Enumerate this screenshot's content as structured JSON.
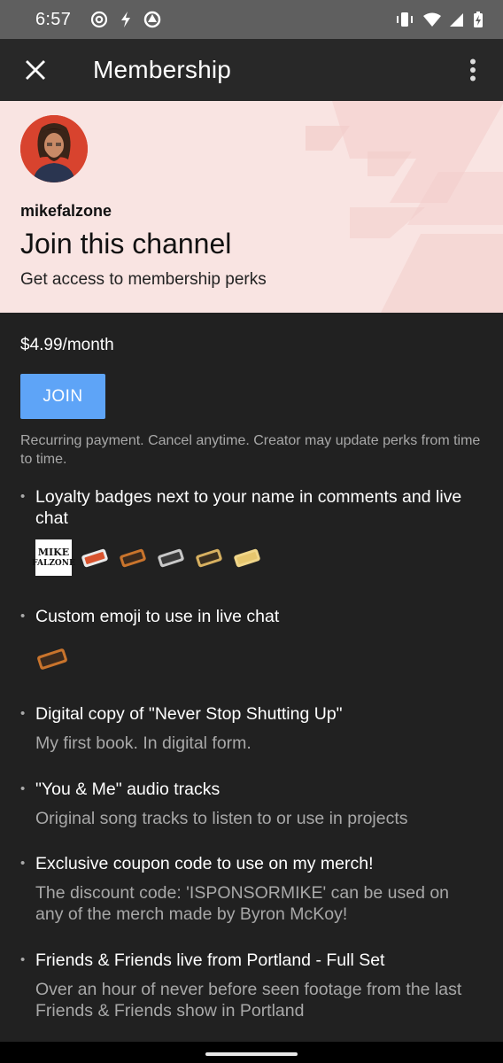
{
  "status_bar": {
    "time": "6:57"
  },
  "app_bar": {
    "title": "Membership"
  },
  "header": {
    "channel_name": "mikefalzone",
    "heading": "Join this channel",
    "subheading": "Get access to membership perks"
  },
  "membership": {
    "price": "$4.99/month",
    "join_label": "JOIN",
    "disclaimer": "Recurring payment. Cancel anytime. Creator may update perks from time to time."
  },
  "badge_logo": {
    "line1": "MIKE",
    "line2": "FALZONE"
  },
  "perks": [
    {
      "title": "Loyalty badges next to your name in comments and live chat",
      "description": ""
    },
    {
      "title": "Custom emoji to use in live chat",
      "description": ""
    },
    {
      "title": "Digital copy of \"Never Stop Shutting Up\"",
      "description": "My first book. In digital form."
    },
    {
      "title": "\"You & Me\" audio tracks",
      "description": "Original song tracks to listen to or use in projects"
    },
    {
      "title": "Exclusive coupon code to use on my merch!",
      "description": "The discount code: 'ISPONSORMIKE' can be used on any of the merch made by Byron McKoy!"
    },
    {
      "title": "Friends & Friends live from Portland - Full Set",
      "description": "Over an hour of never before seen footage from the last Friends & Friends show in Portland"
    }
  ],
  "colors": {
    "banner_bg": "#f9e4e2",
    "join_button": "#5ea4f7",
    "background": "#212121"
  }
}
